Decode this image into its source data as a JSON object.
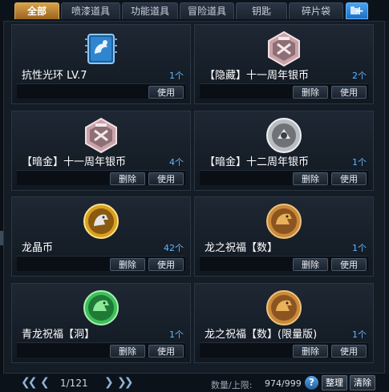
{
  "tabs": [
    {
      "label": "全部",
      "active": true
    },
    {
      "label": "喷漆道具",
      "active": false
    },
    {
      "label": "功能道具",
      "active": false
    },
    {
      "label": "冒险道具",
      "active": false
    },
    {
      "label": "钥匙",
      "active": false
    },
    {
      "label": "碎片袋",
      "active": false
    }
  ],
  "add_tab_icon": "folder-plus-icon",
  "items": [
    {
      "name": "抗性光环 LV.7",
      "count": "1个",
      "icon": "shield-arm-icon",
      "buttons": [
        "使用"
      ]
    },
    {
      "name": "【隐藏】十一周年银币",
      "count": "2个",
      "icon": "silver-hex-coin-icon",
      "buttons": [
        "删除",
        "使用"
      ]
    },
    {
      "name": "【暗金】十一周年银币",
      "count": "4个",
      "icon": "silver-hex-coin-icon",
      "buttons": [
        "删除",
        "使用"
      ]
    },
    {
      "name": "【暗金】十二周年银币",
      "count": "1个",
      "icon": "silver-round-coin-icon",
      "buttons": [
        "删除",
        "使用"
      ]
    },
    {
      "name": "龙晶币",
      "count": "42个",
      "icon": "gold-dragon-coin-icon",
      "buttons": [
        "删除",
        "使用"
      ]
    },
    {
      "name": "龙之祝福【数】",
      "count": "1个",
      "icon": "bronze-dragon-coin-icon",
      "buttons": [
        "删除",
        "使用"
      ]
    },
    {
      "name": "青龙祝福【洞】",
      "count": "1个",
      "icon": "green-dragon-coin-icon",
      "buttons": [
        "删除",
        "使用"
      ]
    },
    {
      "name": "龙之祝福【数】(限量版)",
      "count": "1个",
      "icon": "bronze-dragon-coin-icon",
      "buttons": [
        "删除",
        "使用"
      ]
    }
  ],
  "footer": {
    "first_icon": "double-chevron-left-icon",
    "prev_icon": "chevron-left-icon",
    "page": "1/121",
    "next_icon": "chevron-right-icon",
    "last_icon": "double-chevron-right-icon",
    "capacity_label": "数量/上限:",
    "capacity_value": "974/999",
    "help": "?",
    "sort_label": "整理",
    "clear_label": "清除"
  },
  "colors": {
    "active_tab": "#c98a34",
    "count_text": "#5fb7ff",
    "add_tab": "#2a86dc"
  }
}
